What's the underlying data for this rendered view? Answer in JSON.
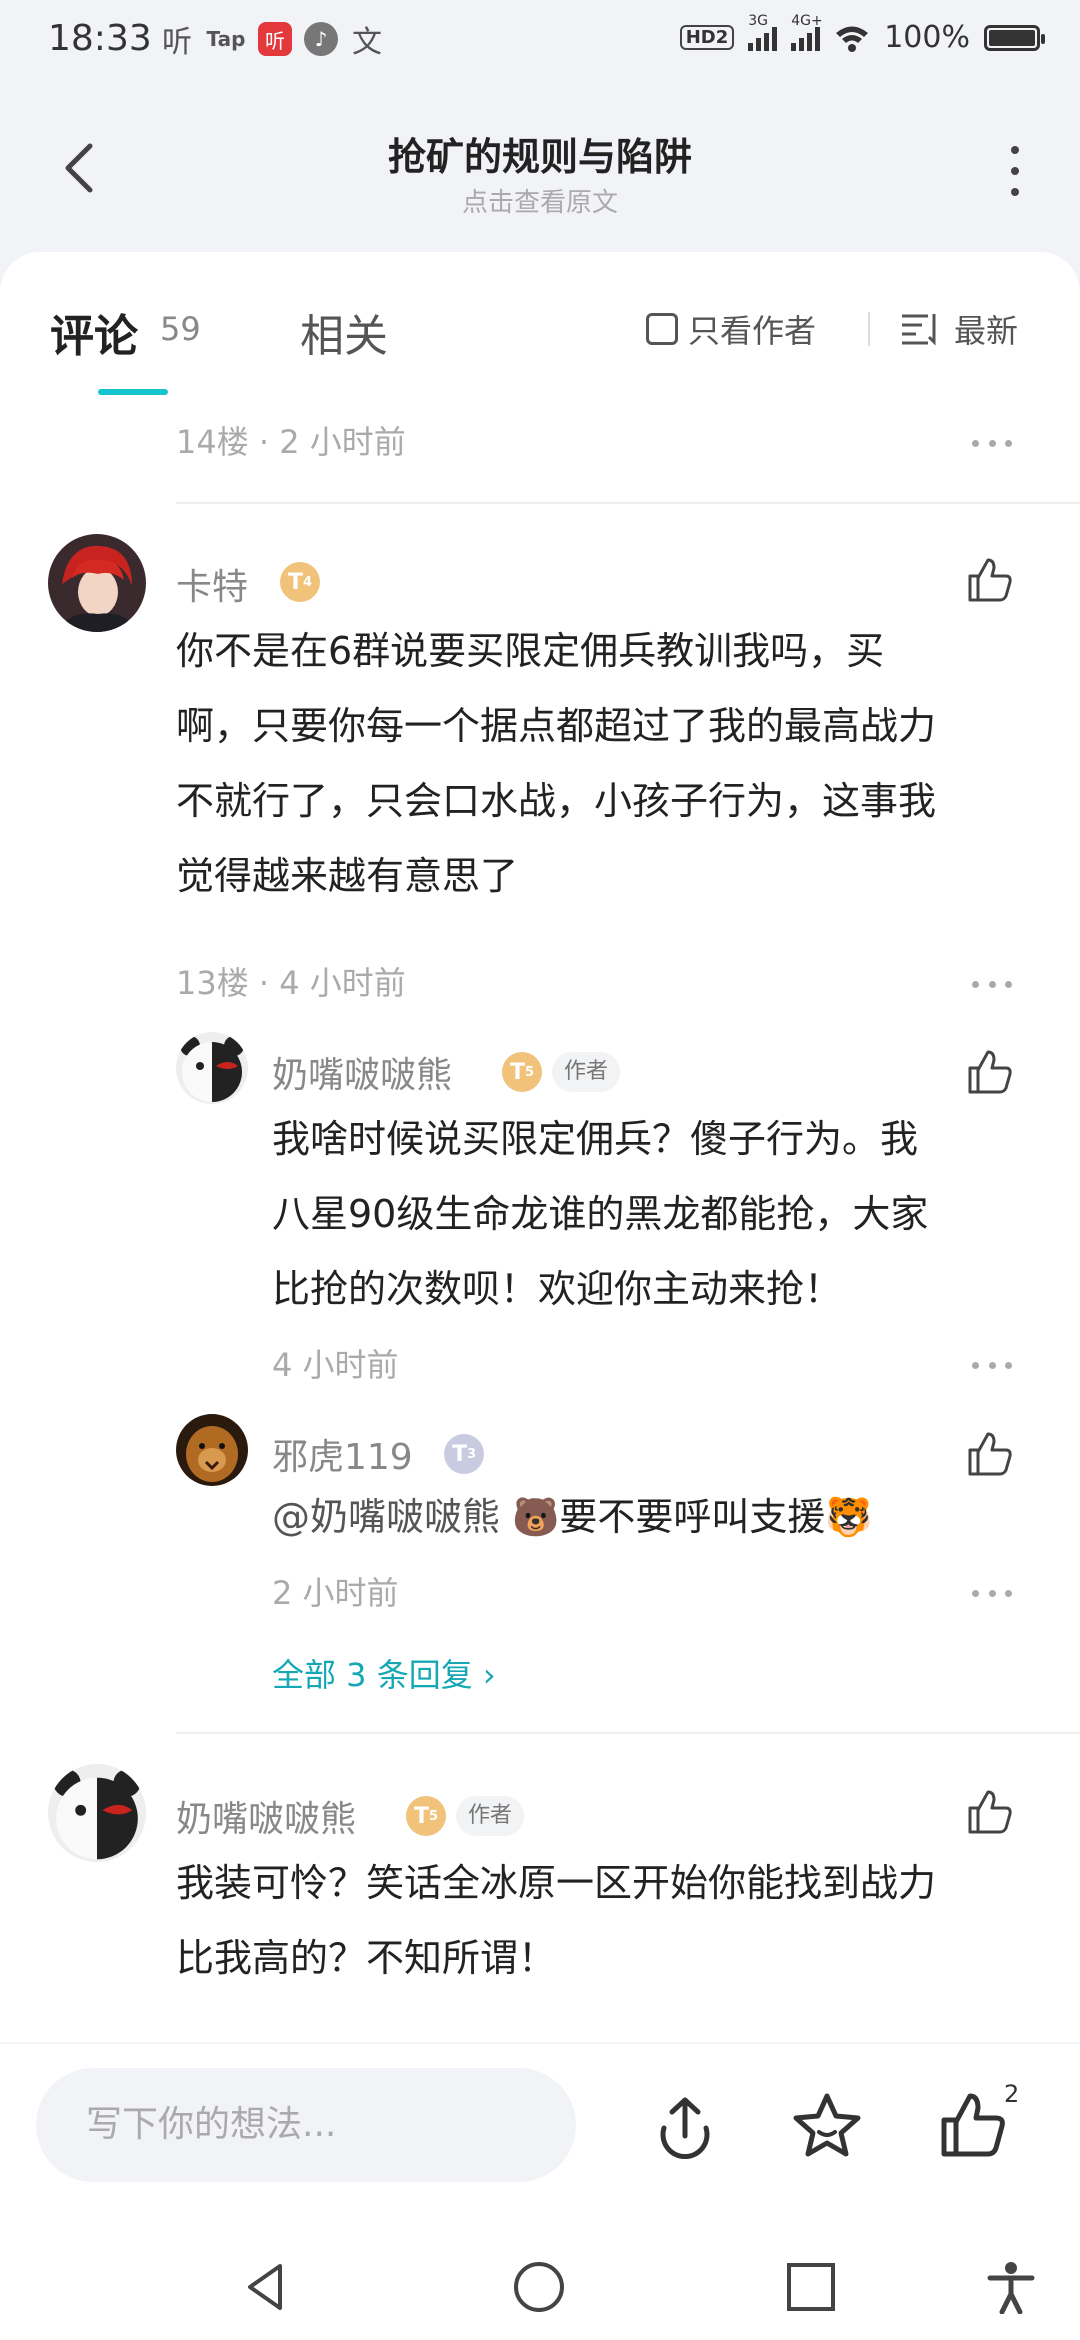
{
  "status_bar": {
    "time": "18:33",
    "apps": [
      "听",
      "Tap",
      "听",
      "",
      "文"
    ],
    "hd": "HD2",
    "net1": "3G",
    "net2": "4G+",
    "battery_percent": "100%"
  },
  "header": {
    "title": "抢矿的规则与陷阱",
    "subtitle": "点击查看原文"
  },
  "tabs": {
    "comments_label": "评论",
    "comments_count": "59",
    "related_label": "相关",
    "author_only_label": "只看作者",
    "sort_label": "最新"
  },
  "comments": [
    {
      "meta": "14楼 · 2 小时前"
    },
    {
      "username": "卡特",
      "level": "4",
      "text_lines": [
        "你不是在6群说要买限定佣兵教训我吗，买",
        "啊，只要你每一个据点都超过了我的最高战力",
        "不就行了，只会口水战，小孩子行为，这事我",
        "觉得越来越有意思了"
      ],
      "meta": "13楼 · 4 小时前",
      "replies": [
        {
          "username": "奶嘴啵啵熊",
          "level": "5",
          "tag": "作者",
          "text_lines": [
            "我啥时候说买限定佣兵？傻子行为。我",
            "八星90级生命龙谁的黑龙都能抢，大家",
            "比抢的次数呗！欢迎你主动来抢！"
          ],
          "meta": "4 小时前"
        },
        {
          "username": "邪虎119",
          "level": "3",
          "mention": "@奶嘴啵啵熊",
          "text": " 🐻要不要呼叫支援🐯",
          "meta": "2 小时前"
        }
      ],
      "all_replies_label": "全部 3 条回复 ›"
    },
    {
      "username": "奶嘴啵啵熊",
      "level": "5",
      "tag": "作者",
      "text_lines": [
        "我装可怜？笑话全冰原一区开始你能找到战力",
        "比我高的？不知所谓！"
      ]
    }
  ],
  "bottom_bar": {
    "input_placeholder": "写下你的想法...",
    "like_count": "2"
  },
  "colors": {
    "accent": "#15c5ce",
    "link": "#15a8b4",
    "badge_gold": "#f0c27a",
    "badge_silver": "#c9cbe0"
  }
}
